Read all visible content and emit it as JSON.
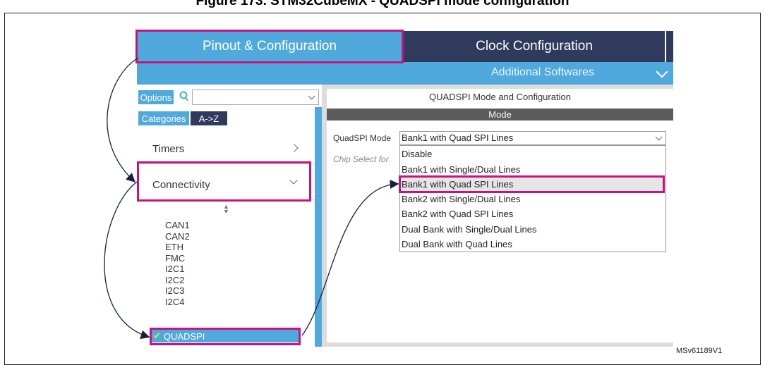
{
  "caption": "Figure 173. STM32CubeMX - QUADSPI mode configuration",
  "tabs": {
    "pinout": "Pinout & Configuration",
    "clock": "Clock Configuration"
  },
  "additional_softwares": "Additional Softwares",
  "left": {
    "options_label": "Options",
    "categories_label": "Categories",
    "az_label": "A->Z",
    "categories": {
      "timers": "Timers",
      "connectivity": "Connectivity"
    },
    "peripherals": [
      "CAN1",
      "CAN2",
      "ETH",
      "FMC",
      "I2C1",
      "I2C2",
      "I2C3",
      "I2C4"
    ],
    "selected_peripheral": "QUADSPI"
  },
  "right": {
    "title": "QUADSPI Mode and Configuration",
    "mode_header": "Mode",
    "mode_label": "QuadSPI Mode",
    "mode_value": "Bank1 with Quad SPI Lines",
    "chip_select_label": "Chip Select for",
    "options": [
      "Disable",
      "Bank1 with Single/Dual Lines",
      "Bank1 with Quad SPI Lines",
      "Bank2 with Single/Dual Lines",
      "Bank2 with Quad SPI Lines",
      "Dual Bank with Single/Dual Lines",
      "Dual Bank with Quad Lines"
    ]
  },
  "reference_id": "MSv61189V1",
  "colors": {
    "tab_blue": "#4fa9dd",
    "tab_dark": "#2f3a5c",
    "highlight": "#c8147a",
    "check_green": "#b6e34a"
  }
}
